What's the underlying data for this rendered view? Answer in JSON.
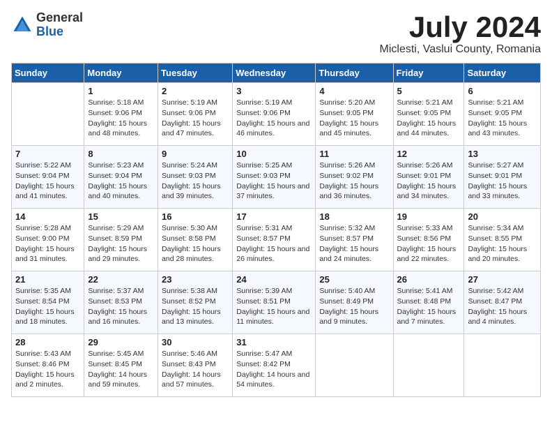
{
  "header": {
    "logo_general": "General",
    "logo_blue": "Blue",
    "month_title": "July 2024",
    "location": "Miclesti, Vaslui County, Romania"
  },
  "weekdays": [
    "Sunday",
    "Monday",
    "Tuesday",
    "Wednesday",
    "Thursday",
    "Friday",
    "Saturday"
  ],
  "weeks": [
    [
      {
        "day": "",
        "empty": true
      },
      {
        "day": "1",
        "sunrise": "5:18 AM",
        "sunset": "9:06 PM",
        "daylight": "15 hours and 48 minutes."
      },
      {
        "day": "2",
        "sunrise": "5:19 AM",
        "sunset": "9:06 PM",
        "daylight": "15 hours and 47 minutes."
      },
      {
        "day": "3",
        "sunrise": "5:19 AM",
        "sunset": "9:06 PM",
        "daylight": "15 hours and 46 minutes."
      },
      {
        "day": "4",
        "sunrise": "5:20 AM",
        "sunset": "9:05 PM",
        "daylight": "15 hours and 45 minutes."
      },
      {
        "day": "5",
        "sunrise": "5:21 AM",
        "sunset": "9:05 PM",
        "daylight": "15 hours and 44 minutes."
      },
      {
        "day": "6",
        "sunrise": "5:21 AM",
        "sunset": "9:05 PM",
        "daylight": "15 hours and 43 minutes."
      }
    ],
    [
      {
        "day": "7",
        "sunrise": "5:22 AM",
        "sunset": "9:04 PM",
        "daylight": "15 hours and 41 minutes."
      },
      {
        "day": "8",
        "sunrise": "5:23 AM",
        "sunset": "9:04 PM",
        "daylight": "15 hours and 40 minutes."
      },
      {
        "day": "9",
        "sunrise": "5:24 AM",
        "sunset": "9:03 PM",
        "daylight": "15 hours and 39 minutes."
      },
      {
        "day": "10",
        "sunrise": "5:25 AM",
        "sunset": "9:03 PM",
        "daylight": "15 hours and 37 minutes."
      },
      {
        "day": "11",
        "sunrise": "5:26 AM",
        "sunset": "9:02 PM",
        "daylight": "15 hours and 36 minutes."
      },
      {
        "day": "12",
        "sunrise": "5:26 AM",
        "sunset": "9:01 PM",
        "daylight": "15 hours and 34 minutes."
      },
      {
        "day": "13",
        "sunrise": "5:27 AM",
        "sunset": "9:01 PM",
        "daylight": "15 hours and 33 minutes."
      }
    ],
    [
      {
        "day": "14",
        "sunrise": "5:28 AM",
        "sunset": "9:00 PM",
        "daylight": "15 hours and 31 minutes."
      },
      {
        "day": "15",
        "sunrise": "5:29 AM",
        "sunset": "8:59 PM",
        "daylight": "15 hours and 29 minutes."
      },
      {
        "day": "16",
        "sunrise": "5:30 AM",
        "sunset": "8:58 PM",
        "daylight": "15 hours and 28 minutes."
      },
      {
        "day": "17",
        "sunrise": "5:31 AM",
        "sunset": "8:57 PM",
        "daylight": "15 hours and 26 minutes."
      },
      {
        "day": "18",
        "sunrise": "5:32 AM",
        "sunset": "8:57 PM",
        "daylight": "15 hours and 24 minutes."
      },
      {
        "day": "19",
        "sunrise": "5:33 AM",
        "sunset": "8:56 PM",
        "daylight": "15 hours and 22 minutes."
      },
      {
        "day": "20",
        "sunrise": "5:34 AM",
        "sunset": "8:55 PM",
        "daylight": "15 hours and 20 minutes."
      }
    ],
    [
      {
        "day": "21",
        "sunrise": "5:35 AM",
        "sunset": "8:54 PM",
        "daylight": "15 hours and 18 minutes."
      },
      {
        "day": "22",
        "sunrise": "5:37 AM",
        "sunset": "8:53 PM",
        "daylight": "15 hours and 16 minutes."
      },
      {
        "day": "23",
        "sunrise": "5:38 AM",
        "sunset": "8:52 PM",
        "daylight": "15 hours and 13 minutes."
      },
      {
        "day": "24",
        "sunrise": "5:39 AM",
        "sunset": "8:51 PM",
        "daylight": "15 hours and 11 minutes."
      },
      {
        "day": "25",
        "sunrise": "5:40 AM",
        "sunset": "8:49 PM",
        "daylight": "15 hours and 9 minutes."
      },
      {
        "day": "26",
        "sunrise": "5:41 AM",
        "sunset": "8:48 PM",
        "daylight": "15 hours and 7 minutes."
      },
      {
        "day": "27",
        "sunrise": "5:42 AM",
        "sunset": "8:47 PM",
        "daylight": "15 hours and 4 minutes."
      }
    ],
    [
      {
        "day": "28",
        "sunrise": "5:43 AM",
        "sunset": "8:46 PM",
        "daylight": "15 hours and 2 minutes."
      },
      {
        "day": "29",
        "sunrise": "5:45 AM",
        "sunset": "8:45 PM",
        "daylight": "14 hours and 59 minutes."
      },
      {
        "day": "30",
        "sunrise": "5:46 AM",
        "sunset": "8:43 PM",
        "daylight": "14 hours and 57 minutes."
      },
      {
        "day": "31",
        "sunrise": "5:47 AM",
        "sunset": "8:42 PM",
        "daylight": "14 hours and 54 minutes."
      },
      {
        "day": "",
        "empty": true
      },
      {
        "day": "",
        "empty": true
      },
      {
        "day": "",
        "empty": true
      }
    ]
  ]
}
